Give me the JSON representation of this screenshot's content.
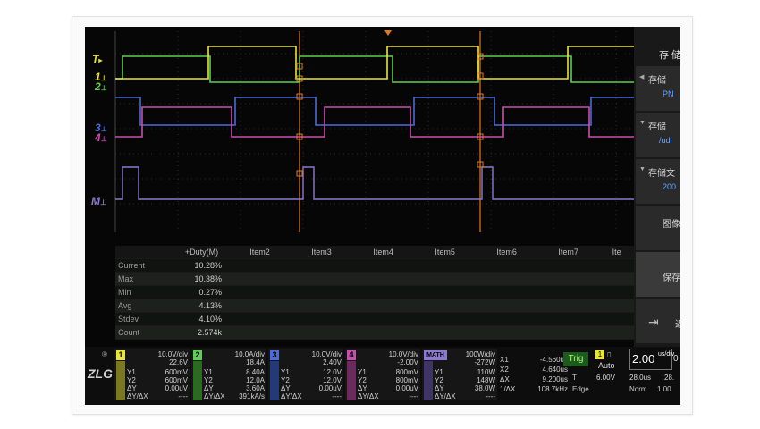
{
  "right_menu": {
    "title": "存 储",
    "items": [
      {
        "label": "存储",
        "value": "PN"
      },
      {
        "label": "存储",
        "value": "/udi"
      },
      {
        "label": "存储文",
        "value": "200"
      },
      {
        "label": "图像",
        "value": ""
      },
      {
        "label": "保存",
        "value": ""
      },
      {
        "label": "返",
        "value": ""
      }
    ]
  },
  "channel_markers": {
    "trigger": "T",
    "ch1": "1",
    "ch2": "2",
    "ch3": "3",
    "ch4": "4",
    "math": "M"
  },
  "measurement": {
    "headers": [
      "+Duty(M)",
      "Item2",
      "Item3",
      "Item4",
      "Item5",
      "Item6",
      "Item7",
      "Ite"
    ],
    "rows": [
      {
        "label": "Current",
        "value": "10.28%"
      },
      {
        "label": "Max",
        "value": "10.38%"
      },
      {
        "label": "Min",
        "value": "0.27%"
      },
      {
        "label": "Avg",
        "value": "4.13%"
      },
      {
        "label": "Stdev",
        "value": "4.10%"
      },
      {
        "label": "Count",
        "value": "2.574k"
      }
    ]
  },
  "channels": [
    {
      "num": "1",
      "color": "#e8e43a",
      "scale": "10.0V/div",
      "offset": "22.6V",
      "y1": "600mV",
      "y2": "600mV",
      "dy": "0.00uV",
      "f": "----"
    },
    {
      "num": "2",
      "color": "#5fcf4f",
      "scale": "10.0A/div",
      "offset": "18.4A",
      "y1": "8.40A",
      "y2": "12.0A",
      "dy": "3.60A",
      "f": "391kA/s"
    },
    {
      "num": "3",
      "color": "#4a6bd8",
      "scale": "10.0V/div",
      "offset": "2.40V",
      "y1": "12.0V",
      "y2": "12.0V",
      "dy": "0.00uV",
      "f": "----"
    },
    {
      "num": "4",
      "color": "#c84fb0",
      "scale": "10.0V/div",
      "offset": "-2.00V",
      "y1": "800mV",
      "y2": "800mV",
      "dy": "0.00uV",
      "f": "----"
    },
    {
      "num": "MATH",
      "color": "#8c7ad0",
      "scale": "100W/div",
      "offset": "-272W",
      "y1": "110W",
      "y2": "148W",
      "dy": "38.0W",
      "f": "----"
    }
  ],
  "cursor": {
    "x1": "-4.560us",
    "x2": "4.640us",
    "dx": "9.200us",
    "inv_dx": "108.7kHz"
  },
  "trigger": {
    "label": "Trig",
    "mode": "Auto",
    "source": "1",
    "level": "6.00V",
    "type": "Edge",
    "time_scale": "2.00",
    "time_unit": "us/div",
    "delay": "28.0us",
    "delay2": "28.",
    "sample_mode": "Norm",
    "sample_rate": "1.00"
  },
  "logo": "ZLG",
  "colors": {
    "ch1": "#e8e43a",
    "ch2": "#5fcf4f",
    "ch3": "#4a6bd8",
    "ch4": "#c84fb0",
    "math": "#8c7ad0",
    "cursor": "#e07a20"
  }
}
